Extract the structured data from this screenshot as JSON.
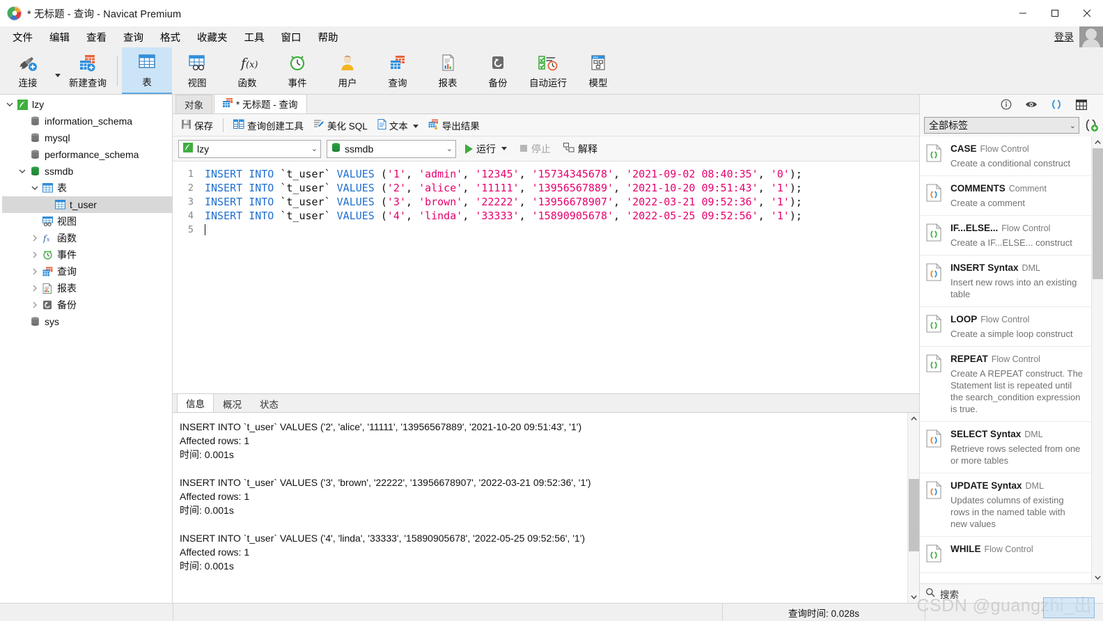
{
  "window": {
    "title": "* 无标题 - 查询 - Navicat Premium",
    "minimize": "—",
    "maximize": "❐",
    "close": "✕"
  },
  "menubar": {
    "items": [
      "文件",
      "编辑",
      "查看",
      "查询",
      "格式",
      "收藏夹",
      "工具",
      "窗口",
      "帮助"
    ],
    "login": "登录"
  },
  "ribbon": {
    "items": [
      {
        "label": "连接",
        "icon": "connection-icon"
      },
      {
        "label": "新建查询",
        "icon": "new-query-icon"
      },
      {
        "label": "表",
        "icon": "table-icon"
      },
      {
        "label": "视图",
        "icon": "view-icon"
      },
      {
        "label": "函数",
        "icon": "function-icon"
      },
      {
        "label": "事件",
        "icon": "event-icon"
      },
      {
        "label": "用户",
        "icon": "user-icon"
      },
      {
        "label": "查询",
        "icon": "query-icon"
      },
      {
        "label": "报表",
        "icon": "report-icon"
      },
      {
        "label": "备份",
        "icon": "backup-icon"
      },
      {
        "label": "自动运行",
        "icon": "automation-icon"
      },
      {
        "label": "模型",
        "icon": "model-icon"
      }
    ],
    "active_label": "表"
  },
  "sidebar": {
    "nodes": [
      {
        "label": "lzy",
        "indent": 0,
        "twist": "down",
        "icon": "connection-leaf-icon"
      },
      {
        "label": "information_schema",
        "indent": 1,
        "twist": "",
        "icon": "database-icon"
      },
      {
        "label": "mysql",
        "indent": 1,
        "twist": "",
        "icon": "database-icon"
      },
      {
        "label": "performance_schema",
        "indent": 1,
        "twist": "",
        "icon": "database-icon"
      },
      {
        "label": "ssmdb",
        "indent": 1,
        "twist": "down",
        "icon": "database-open-icon"
      },
      {
        "label": "表",
        "indent": 2,
        "twist": "down",
        "icon": "table-folder-icon"
      },
      {
        "label": "t_user",
        "indent": 3,
        "twist": "",
        "icon": "table-item-icon",
        "selected": true
      },
      {
        "label": "视图",
        "indent": 2,
        "twist": "",
        "icon": "view-folder-icon"
      },
      {
        "label": "函数",
        "indent": 2,
        "twist": "right",
        "icon": "function-folder-icon"
      },
      {
        "label": "事件",
        "indent": 2,
        "twist": "right",
        "icon": "event-folder-icon"
      },
      {
        "label": "查询",
        "indent": 2,
        "twist": "right",
        "icon": "query-folder-icon"
      },
      {
        "label": "报表",
        "indent": 2,
        "twist": "right",
        "icon": "report-folder-icon"
      },
      {
        "label": "备份",
        "indent": 2,
        "twist": "right",
        "icon": "backup-folder-icon"
      },
      {
        "label": "sys",
        "indent": 1,
        "twist": "",
        "icon": "database-icon"
      }
    ]
  },
  "editor_tabs": {
    "object_tab": "对象",
    "query_tab": "* 无标题 - 查询"
  },
  "query_toolbar": {
    "save": "保存",
    "query_builder": "查询创建工具",
    "beautify": "美化 SQL",
    "text": "文本",
    "export_result": "导出结果"
  },
  "connection_bar": {
    "connection": "lzy",
    "database": "ssmdb",
    "run": "运行",
    "stop": "停止",
    "explain": "解释"
  },
  "sql": {
    "lines": [
      {
        "n": "1",
        "tokens": [
          {
            "t": "INSERT INTO ",
            "c": "k"
          },
          {
            "t": "`t_user`",
            "c": "tbl"
          },
          {
            "t": " ",
            "c": "pun"
          },
          {
            "t": "VALUES",
            "c": "k"
          },
          {
            "t": " (",
            "c": "pun"
          },
          {
            "t": "'1'",
            "c": "str"
          },
          {
            "t": ", ",
            "c": "pun"
          },
          {
            "t": "'admin'",
            "c": "str"
          },
          {
            "t": ", ",
            "c": "pun"
          },
          {
            "t": "'12345'",
            "c": "str"
          },
          {
            "t": ", ",
            "c": "pun"
          },
          {
            "t": "'15734345678'",
            "c": "str"
          },
          {
            "t": ", ",
            "c": "pun"
          },
          {
            "t": "'2021-09-02 08:40:35'",
            "c": "str"
          },
          {
            "t": ", ",
            "c": "pun"
          },
          {
            "t": "'0'",
            "c": "str"
          },
          {
            "t": ");",
            "c": "pun"
          }
        ]
      },
      {
        "n": "2",
        "tokens": [
          {
            "t": "INSERT INTO ",
            "c": "k"
          },
          {
            "t": "`t_user`",
            "c": "tbl"
          },
          {
            "t": " ",
            "c": "pun"
          },
          {
            "t": "VALUES",
            "c": "k"
          },
          {
            "t": " (",
            "c": "pun"
          },
          {
            "t": "'2'",
            "c": "str"
          },
          {
            "t": ", ",
            "c": "pun"
          },
          {
            "t": "'alice'",
            "c": "str"
          },
          {
            "t": ", ",
            "c": "pun"
          },
          {
            "t": "'11111'",
            "c": "str"
          },
          {
            "t": ", ",
            "c": "pun"
          },
          {
            "t": "'13956567889'",
            "c": "str"
          },
          {
            "t": ", ",
            "c": "pun"
          },
          {
            "t": "'2021-10-20 09:51:43'",
            "c": "str"
          },
          {
            "t": ", ",
            "c": "pun"
          },
          {
            "t": "'1'",
            "c": "str"
          },
          {
            "t": ");",
            "c": "pun"
          }
        ]
      },
      {
        "n": "3",
        "tokens": [
          {
            "t": "INSERT INTO ",
            "c": "k"
          },
          {
            "t": "`t_user`",
            "c": "tbl"
          },
          {
            "t": " ",
            "c": "pun"
          },
          {
            "t": "VALUES",
            "c": "k"
          },
          {
            "t": " (",
            "c": "pun"
          },
          {
            "t": "'3'",
            "c": "str"
          },
          {
            "t": ", ",
            "c": "pun"
          },
          {
            "t": "'brown'",
            "c": "str"
          },
          {
            "t": ", ",
            "c": "pun"
          },
          {
            "t": "'22222'",
            "c": "str"
          },
          {
            "t": ", ",
            "c": "pun"
          },
          {
            "t": "'13956678907'",
            "c": "str"
          },
          {
            "t": ", ",
            "c": "pun"
          },
          {
            "t": "'2022-03-21 09:52:36'",
            "c": "str"
          },
          {
            "t": ", ",
            "c": "pun"
          },
          {
            "t": "'1'",
            "c": "str"
          },
          {
            "t": ");",
            "c": "pun"
          }
        ]
      },
      {
        "n": "4",
        "tokens": [
          {
            "t": "INSERT INTO ",
            "c": "k"
          },
          {
            "t": "`t_user`",
            "c": "tbl"
          },
          {
            "t": " ",
            "c": "pun"
          },
          {
            "t": "VALUES",
            "c": "k"
          },
          {
            "t": " (",
            "c": "pun"
          },
          {
            "t": "'4'",
            "c": "str"
          },
          {
            "t": ", ",
            "c": "pun"
          },
          {
            "t": "'linda'",
            "c": "str"
          },
          {
            "t": ", ",
            "c": "pun"
          },
          {
            "t": "'33333'",
            "c": "str"
          },
          {
            "t": ", ",
            "c": "pun"
          },
          {
            "t": "'15890905678'",
            "c": "str"
          },
          {
            "t": ", ",
            "c": "pun"
          },
          {
            "t": "'2022-05-25 09:52:56'",
            "c": "str"
          },
          {
            "t": ", ",
            "c": "pun"
          },
          {
            "t": "'1'",
            "c": "str"
          },
          {
            "t": ");",
            "c": "pun"
          }
        ]
      },
      {
        "n": "5",
        "tokens": []
      }
    ]
  },
  "results": {
    "tabs": [
      "信息",
      "概况",
      "状态"
    ],
    "active_tab": "信息",
    "message_text": "INSERT INTO `t_user` VALUES ('2', 'alice', '11111', '13956567889', '2021-10-20 09:51:43', '1')\nAffected rows: 1\n时间: 0.001s\n\nINSERT INTO `t_user` VALUES ('3', 'brown', '22222', '13956678907', '2022-03-21 09:52:36', '1')\nAffected rows: 1\n时间: 0.001s\n\nINSERT INTO `t_user` VALUES ('4', 'linda', '33333', '15890905678', '2022-05-25 09:52:56', '1')\nAffected rows: 1\n时间: 0.001s"
  },
  "right_panel": {
    "header_icons": [
      "info-icon",
      "eye-icon",
      "code-parens-icon",
      "grid-icon"
    ],
    "filter_value": "全部标签",
    "add_snippet_icon": "add-snippet-icon",
    "search_placeholder": "搜索",
    "snippets": [
      {
        "title": "CASE",
        "category": "Flow Control",
        "desc": "Create a conditional construct",
        "icon": "snippet-green-icon"
      },
      {
        "title": "COMMENTS",
        "category": "Comment",
        "desc": "Create a comment",
        "icon": "snippet-orange-icon"
      },
      {
        "title": "IF...ELSE...",
        "category": "Flow Control",
        "desc": "Create a IF...ELSE... construct",
        "icon": "snippet-green-icon"
      },
      {
        "title": "INSERT Syntax",
        "category": "DML",
        "desc": "Insert new rows into an existing table",
        "icon": "snippet-orange-icon"
      },
      {
        "title": "LOOP",
        "category": "Flow Control",
        "desc": "Create a simple loop construct",
        "icon": "snippet-green-icon"
      },
      {
        "title": "REPEAT",
        "category": "Flow Control",
        "desc": "Create A REPEAT construct. The Statement list is repeated until the search_condition expression is true.",
        "icon": "snippet-green-icon"
      },
      {
        "title": "SELECT Syntax",
        "category": "DML",
        "desc": "Retrieve rows selected from one or more tables",
        "icon": "snippet-orange-icon"
      },
      {
        "title": "UPDATE Syntax",
        "category": "DML",
        "desc": "Updates columns of existing rows in the named table with new values",
        "icon": "snippet-orange-icon"
      },
      {
        "title": "WHILE",
        "category": "Flow Control",
        "desc": "",
        "icon": "snippet-green-icon"
      }
    ]
  },
  "statusbar": {
    "query_time": "查询时间: 0.028s"
  },
  "watermark": "CSDN @guangzhi_出",
  "colors": {
    "accent_blue": "#1f6fd0",
    "string_pink": "#e5006e",
    "ribbon_active": "#cce4f7",
    "run_green": "#3fa93f"
  }
}
